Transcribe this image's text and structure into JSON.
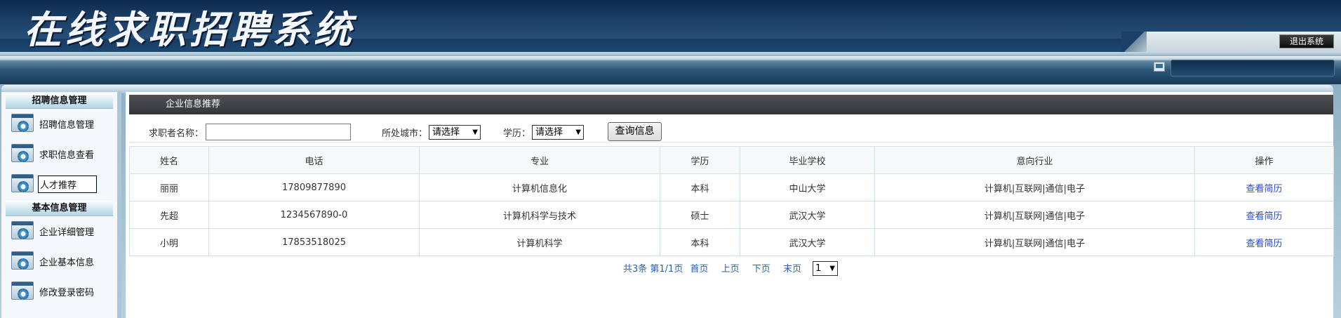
{
  "app": {
    "title": "在线求职招聘系统",
    "logout_label": "退出系统"
  },
  "sidebar": {
    "groups": [
      {
        "title": "招聘信息管理",
        "items": [
          {
            "label": "招聘信息管理",
            "icon": "gear-window-icon"
          },
          {
            "label": "求职信息查看",
            "icon": "gear-window-icon"
          },
          {
            "label": "人才推荐",
            "icon": "gear-window-icon",
            "active": true
          }
        ]
      },
      {
        "title": "基本信息管理",
        "items": [
          {
            "label": "企业详细管理",
            "icon": "gear-window-icon"
          },
          {
            "label": "企业基本信息",
            "icon": "gear-window-icon"
          },
          {
            "label": "修改登录密码",
            "icon": "gear-window-icon"
          }
        ]
      }
    ]
  },
  "main": {
    "title": "企业信息推荐",
    "search": {
      "name_label": "求职者名称：",
      "name_value": "",
      "city_label": "所处城市：",
      "city_selected": "请选择",
      "edu_label": "学历：",
      "edu_selected": "请选择",
      "query_label": "查询信息"
    },
    "table": {
      "headers": [
        "姓名",
        "电话",
        "专业",
        "学历",
        "毕业学校",
        "意向行业",
        "操作"
      ],
      "rows": [
        [
          "丽丽",
          "17809877890",
          "计算机信息化",
          "本科",
          "中山大学",
          "计算机|互联网|通信|电子",
          "查看简历"
        ],
        [
          "先超",
          "1234567890-0",
          "计算机科学与技术",
          "硕士",
          "武汉大学",
          "计算机|互联网|通信|电子",
          "查看简历"
        ],
        [
          "小明",
          "17853518025",
          "计算机科学",
          "本科",
          "武汉大学",
          "计算机|互联网|通信|电子",
          "查看简历"
        ]
      ]
    },
    "pager": {
      "summary": "共3条 第1/1页",
      "first": "首页",
      "prev": "上页",
      "next": "下页",
      "last": "末页",
      "page_selected": "1"
    }
  },
  "colors": {
    "header_dark": "#0f2a4d",
    "content_title_bg": "#3f4145",
    "link": "#2a4dc3"
  }
}
